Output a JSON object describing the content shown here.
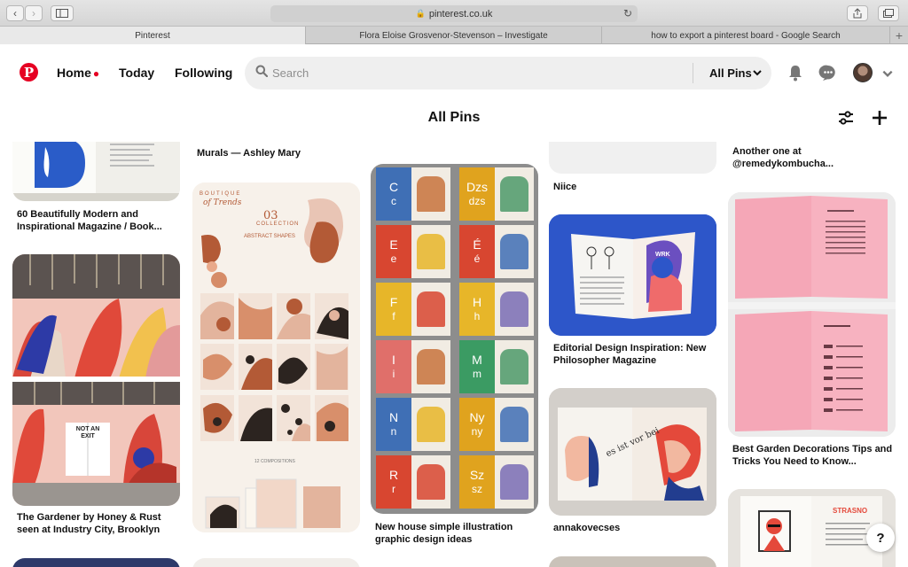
{
  "browser": {
    "url": "pinterest.co.uk",
    "tabs": [
      {
        "label": "Pinterest",
        "active": true
      },
      {
        "label": "Flora Eloise Grosvenor-Stevenson – Investigate",
        "active": false
      },
      {
        "label": "how to export a pinterest board - Google Search",
        "active": false
      }
    ]
  },
  "header": {
    "logo_letter": "P",
    "nav": {
      "home": "Home",
      "today": "Today",
      "following": "Following"
    },
    "search_placeholder": "Search",
    "search_filter": "All Pins"
  },
  "page": {
    "title": "All Pins"
  },
  "pins": {
    "col1_a": "60 Beautifully Modern and Inspirational Magazine / Book...",
    "col1_b": "The Gardener by Honey & Rust seen at Industry City, Brooklyn",
    "col2_a": "Murals — Ashley Mary",
    "col3_a": "New house simple illustration graphic design ideas",
    "col4_a": "Niice",
    "col4_b": "Editorial Design Inspiration: New Philosopher Magazine",
    "col4_c": "annakovecses",
    "col5_a": "Another one at @remedykombucha...",
    "col5_b": "Best Garden Decorations Tips and Tricks You Need to Know..."
  },
  "pin_text": {
    "boutique": "BOUTIQUE",
    "of_trends": "of Trends",
    "collection_num": "03",
    "collection": "COLLECTION",
    "abstract": "ABSTRACT SHAPES",
    "compositions": "12 COMPOSITIONS",
    "wrk": "WRK",
    "not_an_exit": "NOT AN EXIT",
    "strasno": "STRASNO",
    "es_ist": "es ist vor bei"
  },
  "letters": [
    {
      "a": "C",
      "b": "c",
      "color": "#3f6fb5"
    },
    {
      "a": "Dzs",
      "b": "dzs",
      "color": "#e0a31e"
    },
    {
      "a": "E",
      "b": "e",
      "color": "#d84630"
    },
    {
      "a": "É",
      "b": "é",
      "color": "#d84630"
    },
    {
      "a": "F",
      "b": "f",
      "color": "#e7b629"
    },
    {
      "a": "H",
      "b": "h",
      "color": "#e7b629"
    },
    {
      "a": "I",
      "b": "i",
      "color": "#e06f6a"
    },
    {
      "a": "M",
      "b": "m",
      "color": "#3b9b63"
    },
    {
      "a": "N",
      "b": "n",
      "color": "#3f6fb5"
    },
    {
      "a": "Ny",
      "b": "ny",
      "color": "#e0a31e"
    },
    {
      "a": "R",
      "b": "r",
      "color": "#d84630"
    },
    {
      "a": "Sz",
      "b": "sz",
      "color": "#e0a31e"
    }
  ],
  "colors": {
    "brand": "#e60023",
    "search_bg": "#efefef"
  },
  "icons": [
    "pinterest-logo-icon",
    "search-icon",
    "chevron-down-icon",
    "bell-icon",
    "chat-icon",
    "settings-sliders-icon",
    "plus-icon",
    "help-icon"
  ]
}
